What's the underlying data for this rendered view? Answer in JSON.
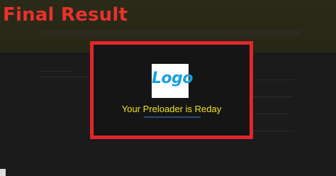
{
  "header": {
    "title": "Final Result"
  },
  "preloader": {
    "logo_text": "Logo",
    "message": "Your Preloader is Reday"
  },
  "colors": {
    "title": "#e8322d",
    "frame": "#e0262c",
    "message": "#f0e21e",
    "logo": "#1aa0e0"
  }
}
